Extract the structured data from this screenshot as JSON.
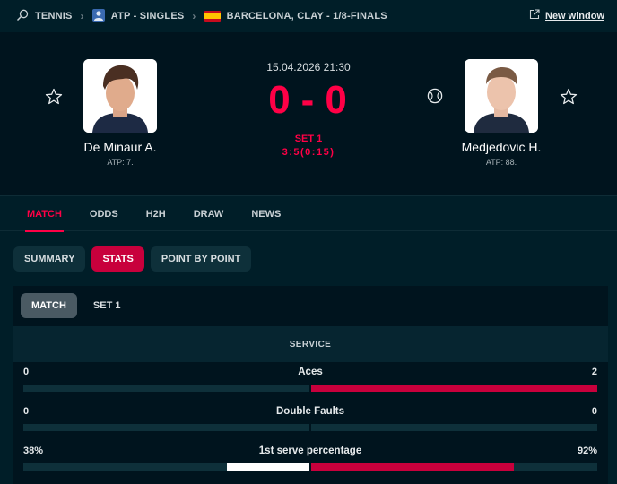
{
  "breadcrumb": {
    "sport": "TENNIS",
    "category": "ATP - SINGLES",
    "tournament": "BARCELONA, CLAY - 1/8-FINALS"
  },
  "new_window_label": "New window",
  "match": {
    "datetime": "15.04.2026 21:30",
    "score_home": "0",
    "score_dash": "-",
    "score_away": "0",
    "set_label": "SET 1",
    "game_score": "3:5(0:15)"
  },
  "home": {
    "name": "De Minaur A.",
    "rank": "ATP: 7."
  },
  "away": {
    "name": "Medjedovic H.",
    "rank": "ATP: 88."
  },
  "tabs": [
    "MATCH",
    "ODDS",
    "H2H",
    "DRAW",
    "NEWS"
  ],
  "subtabs": [
    "SUMMARY",
    "STATS",
    "POINT BY POINT"
  ],
  "periods": [
    "MATCH",
    "SET 1"
  ],
  "section_title": "SERVICE",
  "stats": [
    {
      "label": "Aces",
      "home": "0",
      "away": "2",
      "home_fraction": 0.0,
      "away_fraction": 1.0
    },
    {
      "label": "Double Faults",
      "home": "0",
      "away": "0",
      "home_fraction": 0.0,
      "away_fraction": 0.0
    },
    {
      "label": "1st serve percentage",
      "home": "38%",
      "away": "92%",
      "home_fraction": 0.29,
      "away_fraction": 0.71
    }
  ],
  "colors": {
    "accent": "#ff0046",
    "active_pill": "#c8003c",
    "background": "#001e28"
  },
  "icons": {
    "sport": "tennis-racket-icon",
    "category": "person-icon",
    "country": "spain-flag-icon",
    "favorite": "star-icon",
    "serve": "tennis-ball-icon",
    "external": "external-link-icon",
    "separator": "chevron-right-icon"
  }
}
